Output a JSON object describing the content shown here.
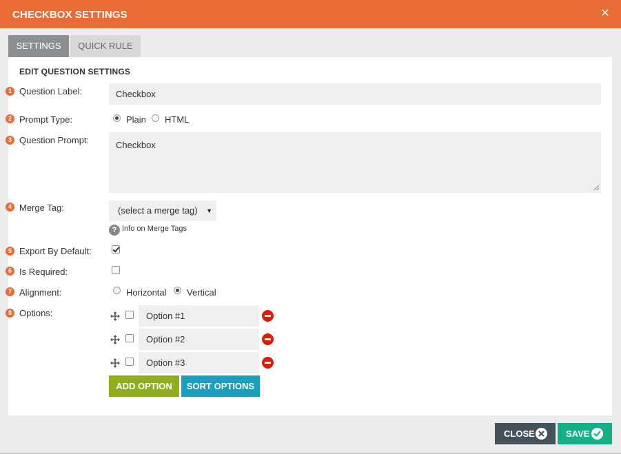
{
  "dialog": {
    "title": "CHECKBOX SETTINGS",
    "close_glyph": "✕"
  },
  "tabs": [
    {
      "label": "SETTINGS",
      "active": true
    },
    {
      "label": "QUICK RULE",
      "active": false
    }
  ],
  "section_title": "EDIT QUESTION SETTINGS",
  "fields": {
    "question_label": {
      "num": "1",
      "label": "Question Label:",
      "value": "Checkbox"
    },
    "prompt_type": {
      "num": "2",
      "label": "Prompt Type:",
      "options": [
        "Plain",
        "HTML"
      ],
      "selected": "Plain"
    },
    "question_prompt": {
      "num": "3",
      "label": "Question Prompt:",
      "value": "Checkbox"
    },
    "merge_tag": {
      "num": "4",
      "label": "Merge Tag:",
      "selected": "(select a merge tag)",
      "help_text": "Info on Merge Tags",
      "help_glyph": "?"
    },
    "export_by_default": {
      "num": "5",
      "label": "Export By Default:",
      "checked": true
    },
    "is_required": {
      "num": "6",
      "label": "Is Required:",
      "checked": false
    },
    "alignment": {
      "num": "7",
      "label": "Alignment:",
      "options": [
        "Horizontal",
        "Vertical"
      ],
      "selected": "Vertical"
    },
    "options": {
      "num": "8",
      "label": "Options:",
      "items": [
        {
          "value": "Option #1",
          "checked": false
        },
        {
          "value": "Option #2",
          "checked": false
        },
        {
          "value": "Option #3",
          "checked": false
        }
      ]
    }
  },
  "buttons": {
    "add_option": "ADD OPTION",
    "sort_options": "SORT OPTIONS",
    "close": "CLOSE",
    "save": "SAVE"
  },
  "colors": {
    "header": "#e96b35",
    "tab_active": "#8b8f94",
    "tab_inactive": "#d8d8d8",
    "add_option": "#8fae1b",
    "sort_options": "#1a9fc0",
    "close_button": "#44525e",
    "save_button": "#16b088",
    "remove_icon": "#e01b0b"
  }
}
